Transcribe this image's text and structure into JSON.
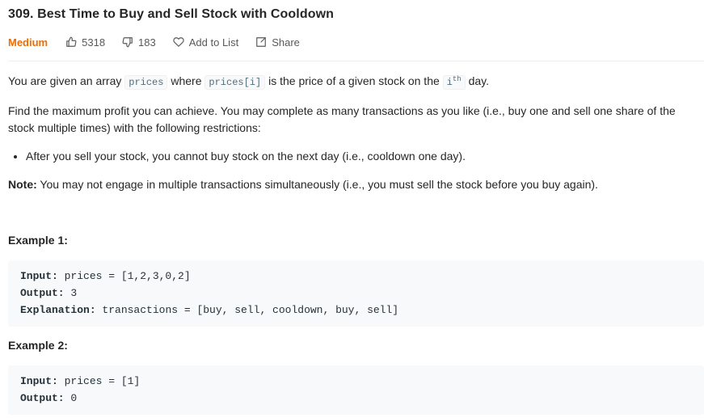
{
  "problem": {
    "title": "309. Best Time to Buy and Sell Stock with Cooldown",
    "difficulty": "Medium",
    "likes": "5318",
    "dislikes": "183",
    "add_to_list": "Add to List",
    "share": "Share"
  },
  "description": {
    "p1_pre": "You are given an array ",
    "p1_code1": "prices",
    "p1_mid": " where ",
    "p1_code2": "prices[i]",
    "p1_mid2": " is the price of a given stock on the ",
    "p1_i": "i",
    "p1_sup": "th",
    "p1_post": " day.",
    "p2": "Find the maximum profit you can achieve. You may complete as many transactions as you like (i.e., buy one and sell one share of the stock multiple times) with the following restrictions:",
    "bullet1": "After you sell your stock, you cannot buy stock on the next day (i.e., cooldown one day).",
    "note_label": "Note:",
    "note_text": " You may not engage in multiple transactions simultaneously (i.e., you must sell the stock before you buy again)."
  },
  "examples": [
    {
      "heading": "Example 1:",
      "input_label": "Input:",
      "input_value": " prices = [1,2,3,0,2]",
      "output_label": "Output:",
      "output_value": " 3",
      "explanation_label": "Explanation:",
      "explanation_value": " transactions = [buy, sell, cooldown, buy, sell]"
    },
    {
      "heading": "Example 2:",
      "input_label": "Input:",
      "input_value": " prices = [1]",
      "output_label": "Output:",
      "output_value": " 0"
    }
  ],
  "colors": {
    "difficulty_medium": "#ef6c00",
    "text": "#262626",
    "meta": "#595959",
    "code_bg": "#f7f9fa"
  }
}
